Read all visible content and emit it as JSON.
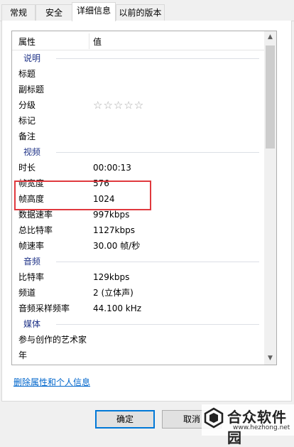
{
  "tabs": [
    {
      "label": "常规"
    },
    {
      "label": "安全"
    },
    {
      "label": "详细信息"
    },
    {
      "label": "以前的版本"
    }
  ],
  "list": {
    "header": {
      "name": "属性",
      "value": "值"
    },
    "groups": {
      "description": "说明",
      "video": "视频",
      "audio": "音频",
      "media": "媒体"
    },
    "rows": {
      "title": {
        "name": "标题",
        "value": ""
      },
      "subtitle": {
        "name": "副标题",
        "value": ""
      },
      "rating": {
        "name": "分级",
        "value": "☆☆☆☆☆"
      },
      "tags": {
        "name": "标记",
        "value": ""
      },
      "comments": {
        "name": "备注",
        "value": ""
      },
      "length": {
        "name": "时长",
        "value": "00:00:13"
      },
      "frame_width": {
        "name": "帧宽度",
        "value": "576"
      },
      "frame_height": {
        "name": "帧高度",
        "value": "1024"
      },
      "data_rate": {
        "name": "数据速率",
        "value": "997kbps"
      },
      "total_bitrate": {
        "name": "总比特率",
        "value": "1127kbps"
      },
      "frame_rate": {
        "name": "帧速率",
        "value": "30.00 帧/秒"
      },
      "audio_bitrate": {
        "name": "比特率",
        "value": "129kbps"
      },
      "channels": {
        "name": "频道",
        "value": "2 (立体声)"
      },
      "sample_rate": {
        "name": "音频采样频率",
        "value": "44.100 kHz"
      },
      "contributing_artists": {
        "name": "参与创作的艺术家",
        "value": ""
      },
      "year": {
        "name": "年",
        "value": ""
      }
    }
  },
  "link": {
    "label": "删除属性和个人信息"
  },
  "buttons": {
    "ok": "确定",
    "cancel": "取消"
  },
  "watermark": {
    "text": "合众软件园",
    "url": "www.hezhong.net"
  },
  "colors": {
    "highlight": "#e0393e",
    "group_label": "#1e3287",
    "link": "#0066cc"
  }
}
